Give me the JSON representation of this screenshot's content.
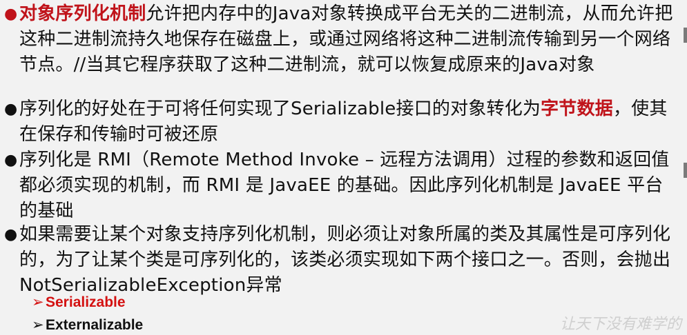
{
  "bullets": [
    {
      "highlight": "对象序列化机制",
      "text": "允许把内存中的Java对象转换成平台无关的二进制流，从而允许把这种二进制流持久地保存在磁盘上，或通过网络将这种二进制流传输到另一个网络节点。//当其它程序获取了这种二进制流，就可以恢复成原来的Java对象"
    },
    {
      "text_before": "序列化的好处在于可将任何实现了Serializable接口的对象转化为",
      "highlight": "字节数据",
      "text_after": "，使其在保存和传输时可被还原"
    },
    {
      "text": "序列化是 RMI（Remote Method Invoke – 远程方法调用）过程的参数和返回值都必须实现的机制，而 RMI 是 JavaEE 的基础。因此序列化机制是 JavaEE 平台的基础"
    },
    {
      "text": "如果需要让某个对象支持序列化机制，则必须让对象所属的类及其属性是可序列化的，为了让某个类是可序列化的，该类必须实现如下两个接口之一。否则，会抛出NotSerializableException异常"
    }
  ],
  "interfaces": [
    {
      "arrow": "➢",
      "label": "Serializable",
      "color": "#d41111"
    },
    {
      "arrow": "➢",
      "label": "Externalizable",
      "color": "#111111"
    }
  ],
  "watermark": "让天下没有难学的"
}
